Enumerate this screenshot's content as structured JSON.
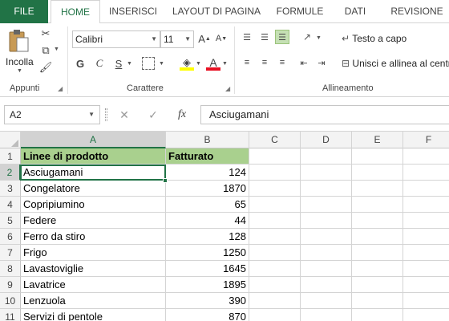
{
  "ribbon_tabs": [
    "FILE",
    "HOME",
    "INSERISCI",
    "LAYOUT DI PAGINA",
    "FORMULE",
    "DATI",
    "REVISIONE"
  ],
  "ribbon": {
    "clipboard": {
      "paste_label": "Incolla",
      "group_label": "Appunti"
    },
    "font": {
      "font_name": "Calibri",
      "font_size": "11",
      "bold": "G",
      "italic": "C",
      "underline": "S",
      "grow_font": "A",
      "shrink_font": "A",
      "font_color_letter": "A",
      "group_label": "Carattere",
      "accent_red": "#e81123",
      "accent_yellow": "#ffff00"
    },
    "alignment": {
      "wrap_text": "Testo a capo",
      "merge_center": "Unisci e allinea al centro",
      "group_label": "Allineamento"
    }
  },
  "formula_bar": {
    "name_box": "A2",
    "cancel": "✕",
    "enter": "✓",
    "fx": "fx",
    "content": "Asciugamani"
  },
  "columns": [
    "A",
    "B",
    "C",
    "D",
    "E",
    "F"
  ],
  "selected_column": "A",
  "selected_row": "2",
  "rows": [
    {
      "num": "1",
      "a": "Linee di prodotto",
      "b": "Fatturato",
      "header": true
    },
    {
      "num": "2",
      "a": "Asciugamani",
      "b": "124"
    },
    {
      "num": "3",
      "a": "Congelatore",
      "b": "1870"
    },
    {
      "num": "4",
      "a": "Copripiumino",
      "b": "65"
    },
    {
      "num": "5",
      "a": "Federe",
      "b": "44"
    },
    {
      "num": "6",
      "a": "Ferro da stiro",
      "b": "128"
    },
    {
      "num": "7",
      "a": "Frigo",
      "b": "1250"
    },
    {
      "num": "8",
      "a": "Lavastoviglie",
      "b": "1645"
    },
    {
      "num": "9",
      "a": "Lavatrice",
      "b": "1895"
    },
    {
      "num": "10",
      "a": "Lenzuola",
      "b": "390"
    },
    {
      "num": "11",
      "a": "Servizi di pentole",
      "b": "870"
    }
  ],
  "colors": {
    "excel_green": "#217346",
    "header_fill": "#a9d08e"
  }
}
